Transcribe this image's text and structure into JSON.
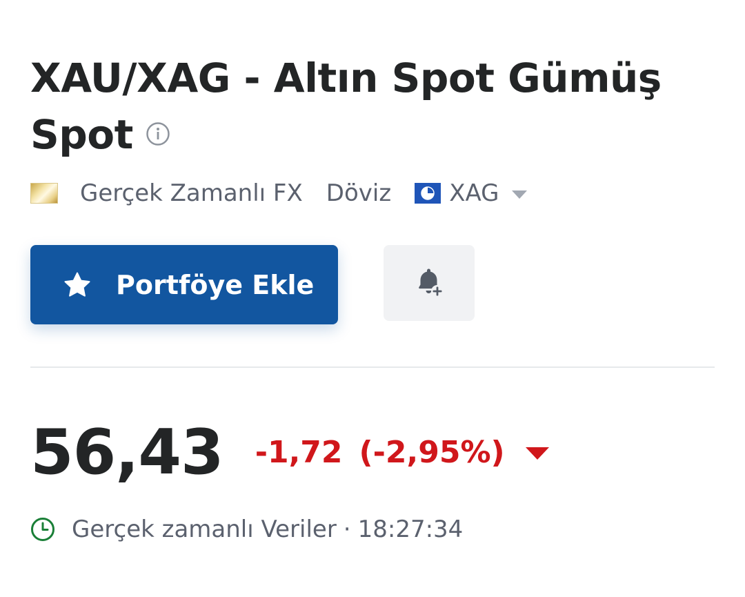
{
  "header": {
    "title": "XAU/XAG - Altın Spot Gümüş Spot"
  },
  "meta": {
    "source": "Gerçek Zamanlı FX",
    "type": "Döviz",
    "currency": "XAG"
  },
  "actions": {
    "portfolio_label": "Portföye Ekle"
  },
  "quote": {
    "price": "56,43",
    "change": "-1,72",
    "change_pct": "(-2,95%)",
    "direction": "down"
  },
  "status": {
    "label": "Gerçek zamanlı Veriler",
    "separator": "·",
    "time": "18:27:34"
  },
  "colors": {
    "accent": "#1256a0",
    "negative": "#d0171b",
    "realtime": "#1a7f37"
  }
}
